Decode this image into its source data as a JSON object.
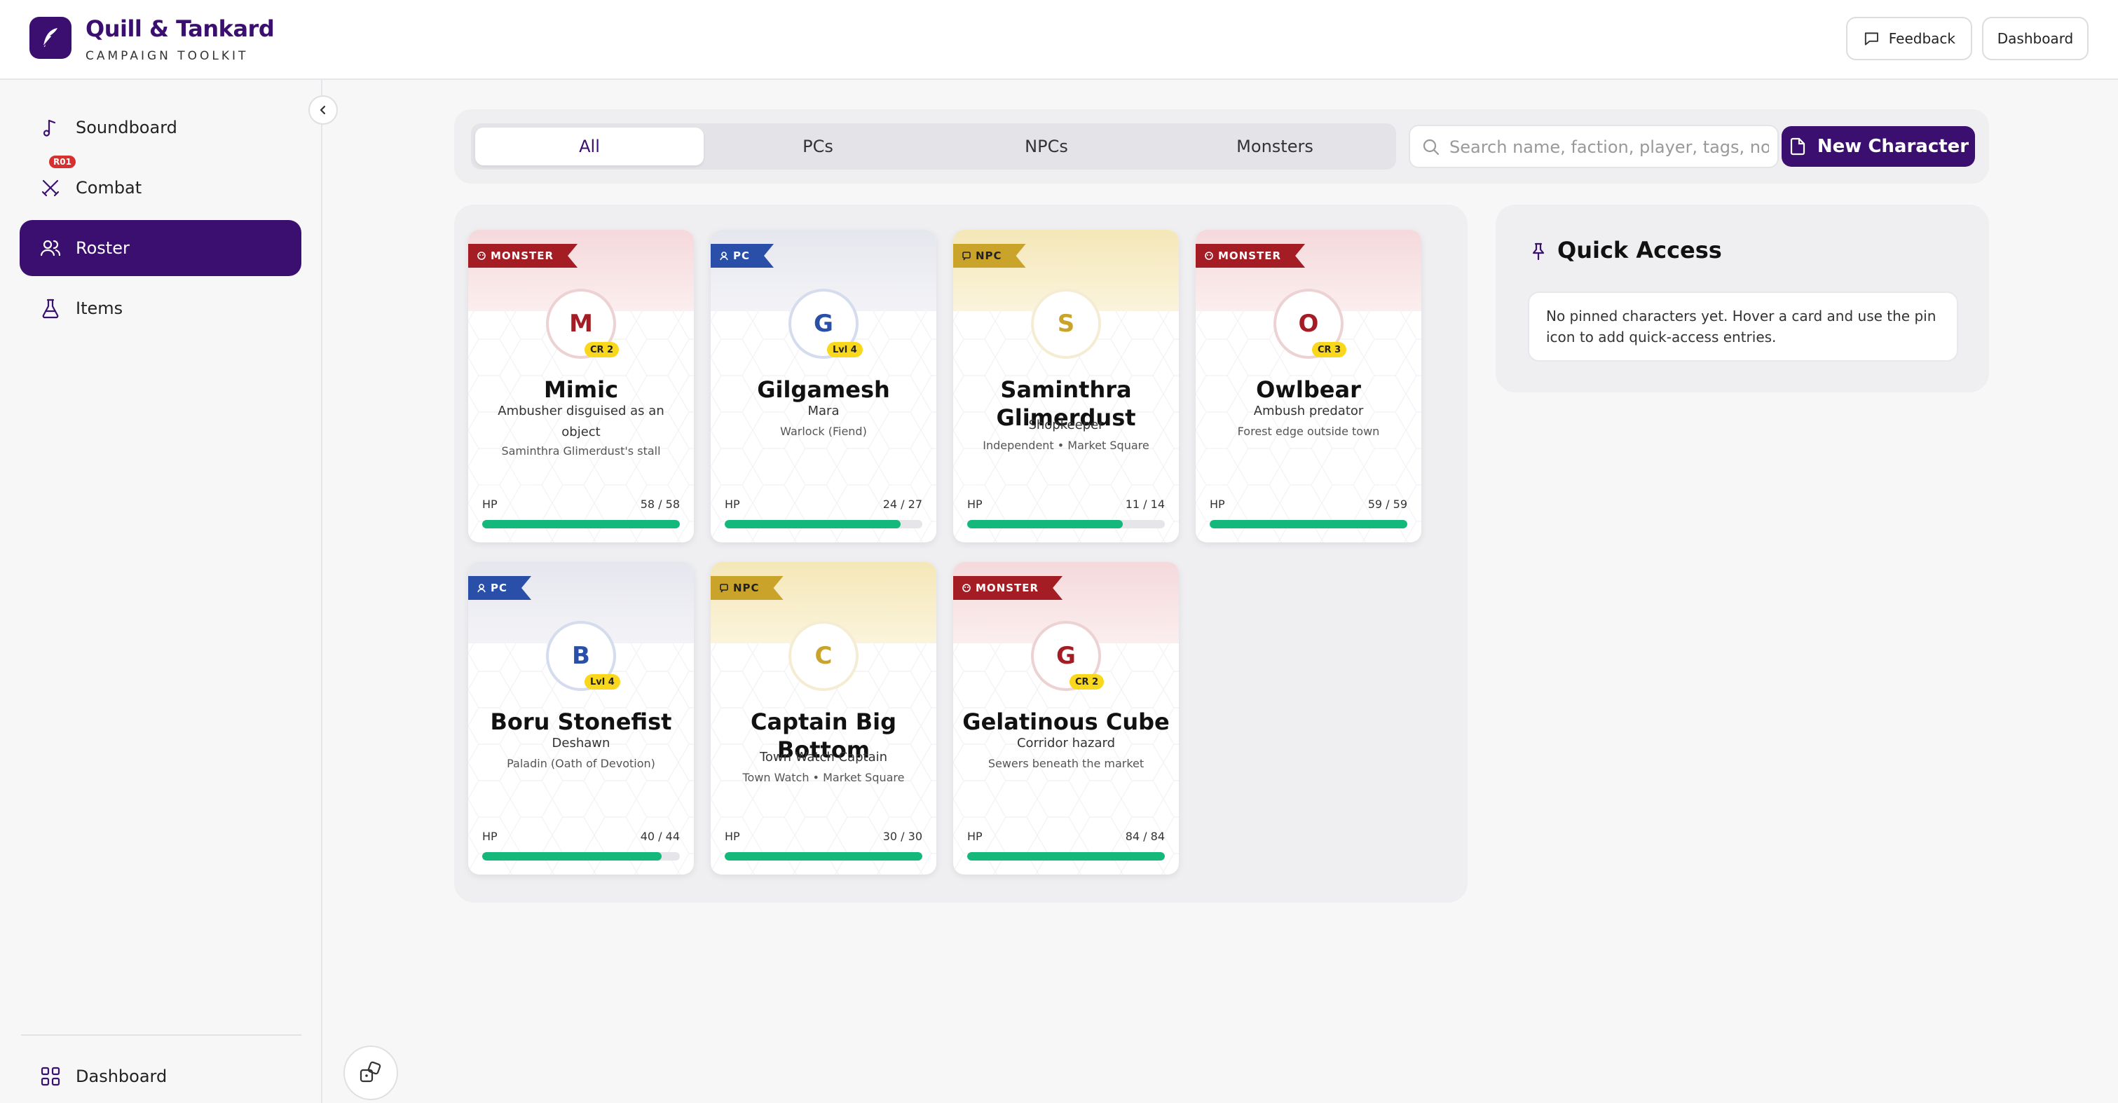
{
  "app": {
    "title": "Quill & Tankard",
    "subtitle": "CAMPAIGN TOOLKIT"
  },
  "header": {
    "feedback_label": "Feedback",
    "dashboard_label": "Dashboard"
  },
  "sidebar": {
    "items": [
      {
        "label": "Soundboard",
        "icon": "music-note-icon"
      },
      {
        "label": "Combat",
        "icon": "crossed-swords-icon",
        "badge": "R01"
      },
      {
        "label": "Roster",
        "icon": "users-icon",
        "active": true
      },
      {
        "label": "Items",
        "icon": "flask-icon"
      }
    ],
    "footer_label": "Dashboard"
  },
  "toolbar": {
    "tabs": [
      "All",
      "PCs",
      "NPCs",
      "Monsters"
    ],
    "selected_tab": "All",
    "search_placeholder": "Search name, faction, player, tags, notes",
    "new_label": "New Character"
  },
  "cards": [
    {
      "type": "MONSTER",
      "initial": "M",
      "level": "CR 2",
      "name": "Mimic",
      "sub": "Ambusher disguised as an object",
      "desc": "Saminthra Glimerdust's stall",
      "hp_label": "HP",
      "hp": "58 / 58",
      "hp_pct": 1.0
    },
    {
      "type": "PC",
      "initial": "G",
      "level": "Lvl 4",
      "name": "Gilgamesh",
      "sub": "Mara",
      "desc": "Warlock (Fiend)",
      "hp_label": "HP",
      "hp": "24 / 27",
      "hp_pct": 0.889
    },
    {
      "type": "NPC",
      "initial": "S",
      "level": "",
      "name": "Saminthra Glimerdust",
      "sub": "Shopkeeper",
      "desc": "Independent • Market Square",
      "hp_label": "HP",
      "hp": "11 / 14",
      "hp_pct": 0.786
    },
    {
      "type": "MONSTER",
      "initial": "O",
      "level": "CR 3",
      "name": "Owlbear",
      "sub": "Ambush predator",
      "desc": "Forest edge outside town",
      "hp_label": "HP",
      "hp": "59 / 59",
      "hp_pct": 1.0
    },
    {
      "type": "PC",
      "initial": "B",
      "level": "Lvl 4",
      "name": "Boru Stonefist",
      "sub": "Deshawn",
      "desc": "Paladin (Oath of Devotion)",
      "hp_label": "HP",
      "hp": "40 / 44",
      "hp_pct": 0.909
    },
    {
      "type": "NPC",
      "initial": "C",
      "level": "",
      "name": "Captain Big Bottom",
      "sub": "Town Watch Captain",
      "desc": "Town Watch • Market Square",
      "hp_label": "HP",
      "hp": "30 / 30",
      "hp_pct": 1.0
    },
    {
      "type": "MONSTER",
      "initial": "G",
      "level": "CR 2",
      "name": "Gelatinous Cube",
      "sub": "Corridor hazard",
      "desc": "Sewers beneath the market",
      "hp_label": "HP",
      "hp": "84 / 84",
      "hp_pct": 1.0
    }
  ],
  "quick_access": {
    "title": "Quick Access",
    "empty": "No pinned characters yet. Hover a card and use the pin icon to add quick-access entries."
  },
  "colors": {
    "brand": "#3b0f70",
    "monster": "#a51d24",
    "pc": "#2a4fa8",
    "npc": "#c9a32a",
    "hp": "#14b87a",
    "level_badge": "#f9d71c"
  }
}
